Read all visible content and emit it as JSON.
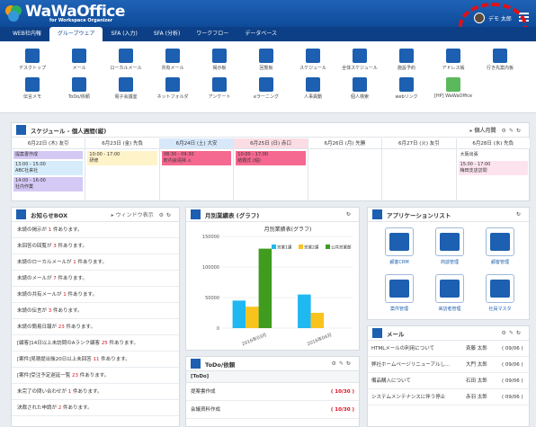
{
  "header": {
    "logo": "WaWaOffice",
    "logo_sub": "for Workspace Organizer",
    "user_name": "デモ 太郎"
  },
  "nav": {
    "tabs": [
      "WEB社内報",
      "グループウェア",
      "SFA (入力)",
      "SFA (分析)",
      "ワークフロー",
      "データベース"
    ],
    "active": 1
  },
  "toolbar": {
    "row1": [
      "デスクトップ",
      "メール",
      "ローカルメール",
      "共有メール",
      "掲示板",
      "回覧板",
      "スケジュール",
      "全体スケジュール",
      "施設予約",
      "アドレス帳",
      "行き先案内板"
    ],
    "row2": [
      "伝言メモ",
      "ToDo/依頼",
      "電子会議室",
      "ネットフォルダ",
      "アンケート",
      "eラーニング",
      "人事異動",
      "個人検索",
      "webリンク",
      "[HP] WaWaOffice"
    ]
  },
  "schedule": {
    "title": "スケジュール - 個人週間(縦)",
    "view_label": "▸ 個人月間",
    "days": [
      {
        "label": "6月22日 (木) 友引",
        "bg": "#ffffff",
        "events": [
          {
            "t": "提案書作成",
            "c": "#d4c8f5"
          },
          {
            "t": "13:00 - 15:00\nABC社来社",
            "c": "#d6ecfa"
          },
          {
            "t": "14:00 - 16:00\n社内作業",
            "c": "#d4c8f5"
          }
        ]
      },
      {
        "label": "6月23日 (金) 先負",
        "bg": "#ffffff",
        "events": [
          {
            "t": "10:00 - 17:00\n研修",
            "c": "#fff3c9"
          }
        ]
      },
      {
        "label": "6月24日 (土) 大安",
        "bg": "#d7e8fb",
        "events": [
          {
            "t": "08:30 - 09:30\n町内会清掃 ⚠",
            "c": "#f5688f"
          }
        ]
      },
      {
        "label": "6月25日 (日) 赤口",
        "bg": "#fbdde3",
        "events": [
          {
            "t": "10:00 - 17:00\n結婚式 (堀)",
            "c": "#f5688f"
          }
        ]
      },
      {
        "label": "6月26日 (月) 先勝",
        "bg": "#ffffff",
        "events": []
      },
      {
        "label": "6月27日 (火) 友引",
        "bg": "#ffffff",
        "events": []
      },
      {
        "label": "6月28日 (水) 先負",
        "bg": "#ffffff",
        "events": [
          {
            "t": "大阪出張",
            "c": "#ffffff"
          },
          {
            "t": "15:00 - 17:00\n梅田支店訪問",
            "c": "#fde3ee"
          }
        ]
      }
    ]
  },
  "news": {
    "title": "お知らせBOX",
    "window_label": "▸ ウィンドウ表示",
    "items": [
      [
        "未読の掲示が ",
        "1",
        " 件あります。"
      ],
      [
        "未回答の回覧が ",
        "3",
        " 件あります。"
      ],
      [
        "未読のローカルメールが ",
        "1",
        " 件あります。"
      ],
      [
        "未読のメールが ",
        "7",
        " 件あります。"
      ],
      [
        "未読の共有メールが ",
        "1",
        " 件あります。"
      ],
      [
        "未読の伝言が ",
        "3",
        " 件あります。"
      ],
      [
        "未読の簡易日報が ",
        "23",
        " 件あります。"
      ],
      [
        "[顧客]14日以上未訪問のAランク顧客 ",
        "25",
        " 件あります。"
      ],
      [
        "[案件]見積提出後20日以上未回答 ",
        "11",
        " 件あります。"
      ],
      [
        "[案件]受注予定遅延一覧 ",
        "23",
        " 件あります。"
      ],
      [
        "未完了の問い合わせが ",
        "1",
        " 件あります。"
      ],
      [
        "決裁された申請が ",
        "2",
        " 件あります。"
      ]
    ]
  },
  "chart_data": {
    "type": "bar",
    "panel_title": "月別業績表 (グラフ)",
    "title": "月別業績表(グラフ)",
    "categories": [
      "2016年03月",
      "2016年04月"
    ],
    "series": [
      {
        "name": "営業1課",
        "values": [
          45000,
          55000
        ],
        "color": "#1fb8f0"
      },
      {
        "name": "営業2課",
        "values": [
          35000,
          25000
        ],
        "color": "#f9c31e"
      },
      {
        "name": "公共営業部",
        "values": [
          130000,
          0
        ],
        "color": "#3f9c1f"
      }
    ],
    "ylim": [
      0,
      150000
    ],
    "yticks": [
      "0",
      "50000",
      "100000",
      "150000"
    ]
  },
  "apps": {
    "title": "アプリケーションリスト",
    "items": [
      "顧客CRM",
      "商談管理",
      "顧客管理",
      "案件管理",
      "来訪者管理",
      "社員マスタ"
    ]
  },
  "todo": {
    "title": "ToDo/依頼",
    "section": "[ToDo]",
    "items": [
      [
        "提案書作成",
        "( 10/30 )"
      ],
      [
        "会議資料作成",
        "( 10/30 )"
      ]
    ]
  },
  "mail": {
    "title": "メール",
    "items": [
      [
        "HTMLメールの利用について",
        "斉藤 太郎",
        "( 09/06 )"
      ],
      [
        "弊社ホームページリニューアルし…",
        "大門 太郎",
        "( 09/06 )"
      ],
      [
        "備品購入について",
        "石田 太郎",
        "( 09/06 )"
      ],
      [
        "システムメンテナンスに伴う停止",
        "赤羽 太郎",
        "( 09/06 )"
      ]
    ]
  }
}
